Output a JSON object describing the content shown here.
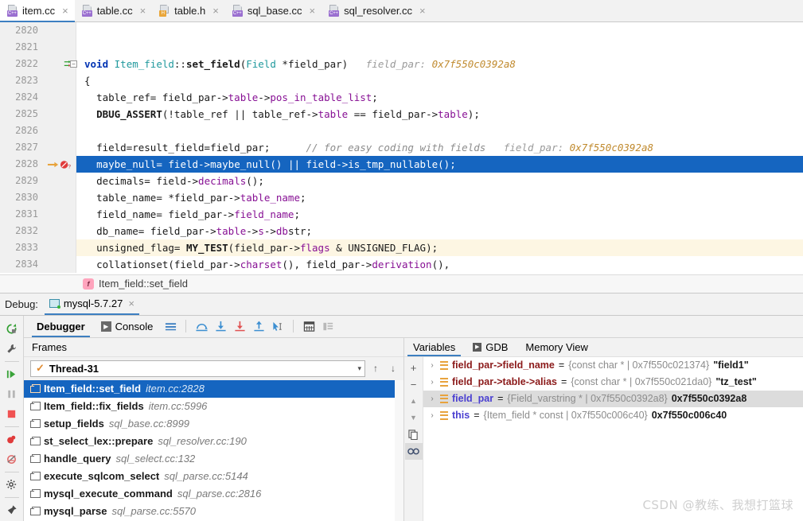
{
  "tabs": [
    {
      "label": "item.cc",
      "icon": "cpp-file-icon",
      "kind": "cpp",
      "active": true,
      "close": "×"
    },
    {
      "label": "table.cc",
      "icon": "cpp-file-icon",
      "kind": "cpp",
      "active": false,
      "close": "×"
    },
    {
      "label": "table.h",
      "icon": "header-file-icon",
      "kind": "h",
      "active": false,
      "close": "×"
    },
    {
      "label": "sql_base.cc",
      "icon": "cpp-file-icon",
      "kind": "cpp",
      "active": false,
      "close": "×"
    },
    {
      "label": "sql_resolver.cc",
      "icon": "cpp-file-icon",
      "kind": "cpp",
      "active": false,
      "close": "×"
    }
  ],
  "editor": {
    "lines": [
      {
        "num": "2820",
        "text": ""
      },
      {
        "num": "2821",
        "text": ""
      },
      {
        "num": "2822",
        "text": "void Item_field::set_field(Field *field_par)",
        "hint": "field_par:",
        "hintval": "0x7f550c0392a8",
        "marker": "jump",
        "fold": true
      },
      {
        "num": "2823",
        "text": "{"
      },
      {
        "num": "2824",
        "text": "  table_ref= field_par->table->pos_in_table_list;"
      },
      {
        "num": "2825",
        "text": "  DBUG_ASSERT(!table_ref || table_ref->table == field_par->table);"
      },
      {
        "num": "2826",
        "text": ""
      },
      {
        "num": "2827",
        "text": "  field=result_field=field_par;",
        "comment": "// for easy coding with fields",
        "hint": "field_par:",
        "hintval": "0x7f550c0392a8"
      },
      {
        "num": "2828",
        "text": "  maybe_null= field->maybe_null() || field->is_tmp_nullable();",
        "selected": true,
        "marker": "breakpoint-current"
      },
      {
        "num": "2829",
        "text": "  decimals= field->decimals();"
      },
      {
        "num": "2830",
        "text": "  table_name= *field_par->table_name;"
      },
      {
        "num": "2831",
        "text": "  field_name= field_par->field_name;"
      },
      {
        "num": "2832",
        "text": "  db_name= field_par->table->s->db.str;"
      },
      {
        "num": "2833",
        "text": "  unsigned_flag= MY_TEST(field_par->flags & UNSIGNED_FLAG);",
        "highlight": true
      },
      {
        "num": "2834",
        "text": "  collation.set(field_par->charset(), field_par->derivation(),"
      }
    ]
  },
  "breadcrumb": {
    "icon": "function-icon",
    "icon_glyph": "f",
    "label": "Item_field::set_field"
  },
  "debug_header": {
    "label": "Debug:",
    "session": "mysql-5.7.27",
    "close": "×",
    "icon": "run-config-icon"
  },
  "debug_toolbar": {
    "tabs": [
      {
        "label": "Debugger",
        "icon": "debugger-tab-icon",
        "active": true
      },
      {
        "label": "Console",
        "icon": "console-tab-icon",
        "active": false
      }
    ],
    "buttons": [
      {
        "name": "layout-settings-icon"
      },
      {
        "name": "step-over-icon"
      },
      {
        "name": "step-into-icon"
      },
      {
        "name": "force-step-into-icon"
      },
      {
        "name": "step-out-icon"
      },
      {
        "name": "run-to-cursor-icon"
      },
      {
        "name": "evaluate-expression-icon"
      },
      {
        "name": "show-values-inline-icon"
      }
    ]
  },
  "rail_buttons": [
    {
      "name": "rerun-icon"
    },
    {
      "name": "edit-configurations-icon"
    },
    {
      "name": "resume-program-icon"
    },
    {
      "name": "pause-program-icon"
    },
    {
      "name": "stop-icon"
    },
    {
      "name": "view-breakpoints-icon"
    },
    {
      "name": "mute-breakpoints-icon"
    },
    {
      "name": "settings-icon"
    },
    {
      "name": "pin-tab-icon"
    }
  ],
  "frames_pane": {
    "title": "Frames",
    "thread": {
      "label": "Thread-31",
      "check": "✓",
      "arrow": "▾"
    },
    "nav": [
      {
        "name": "frames-up-icon",
        "glyph": "↑"
      },
      {
        "name": "frames-down-icon",
        "glyph": "↓"
      }
    ],
    "frames": [
      {
        "name": "Item_field::set_field",
        "loc": "item.cc:2828",
        "selected": true
      },
      {
        "name": "Item_field::fix_fields",
        "loc": "item.cc:5996",
        "selected": false
      },
      {
        "name": "setup_fields",
        "loc": "sql_base.cc:8999",
        "selected": false
      },
      {
        "name": "st_select_lex::prepare",
        "loc": "sql_resolver.cc:190",
        "selected": false
      },
      {
        "name": "handle_query",
        "loc": "sql_select.cc:132",
        "selected": false
      },
      {
        "name": "execute_sqlcom_select",
        "loc": "sql_parse.cc:5144",
        "selected": false
      },
      {
        "name": "mysql_execute_command",
        "loc": "sql_parse.cc:2816",
        "selected": false
      },
      {
        "name": "mysql_parse",
        "loc": "sql_parse.cc:5570",
        "selected": false
      }
    ]
  },
  "vars_pane": {
    "tabs": [
      {
        "label": "Variables",
        "icon": "variables-tab-icon",
        "active": true
      },
      {
        "label": "GDB",
        "icon": "gdb-tab-icon",
        "active": false
      },
      {
        "label": "Memory View",
        "icon": "memory-view-tab-icon",
        "active": false
      }
    ],
    "rail": [
      {
        "name": "add-watch-icon",
        "glyph": "+"
      },
      {
        "name": "remove-watch-icon",
        "glyph": "−"
      },
      {
        "name": "watch-up-icon",
        "glyph": "▲"
      },
      {
        "name": "watch-down-icon",
        "glyph": "▼"
      },
      {
        "name": "copy-value-icon",
        "glyph": ""
      },
      {
        "name": "inspect-icon",
        "glyph": "∞"
      }
    ],
    "variables": [
      {
        "chev": "›",
        "name": "field_par->field_name",
        "style": "red",
        "eq": "=",
        "type": "{const char * | 0x7f550c021374}",
        "value": "\"field1\"",
        "selected": false
      },
      {
        "chev": "›",
        "name": "field_par->table->alias",
        "style": "red",
        "eq": "=",
        "type": "{const char * | 0x7f550c021da0}",
        "value": "\"tz_test\"",
        "selected": false
      },
      {
        "chev": "›",
        "name": "field_par",
        "style": "blue",
        "eq": "=",
        "type": "{Field_varstring * | 0x7f550c0392a8}",
        "value": "0x7f550c0392a8",
        "selected": true
      },
      {
        "chev": "›",
        "name": "this",
        "style": "blue",
        "eq": "=",
        "type": "{Item_field * const | 0x7f550c006c40}",
        "value": "0x7f550c006c40",
        "selected": false
      }
    ]
  },
  "watermark": "CSDN @教练、我想打篮球",
  "colors": {
    "selection_blue": "#1565c0",
    "accent_blue": "#3d7fc1",
    "highlight_cream": "#fdf6e3",
    "keyword": "#0033b3",
    "type": "#20999d",
    "member": "#871094",
    "comment": "#8c8c8c",
    "hint_value": "#c08a2e"
  }
}
